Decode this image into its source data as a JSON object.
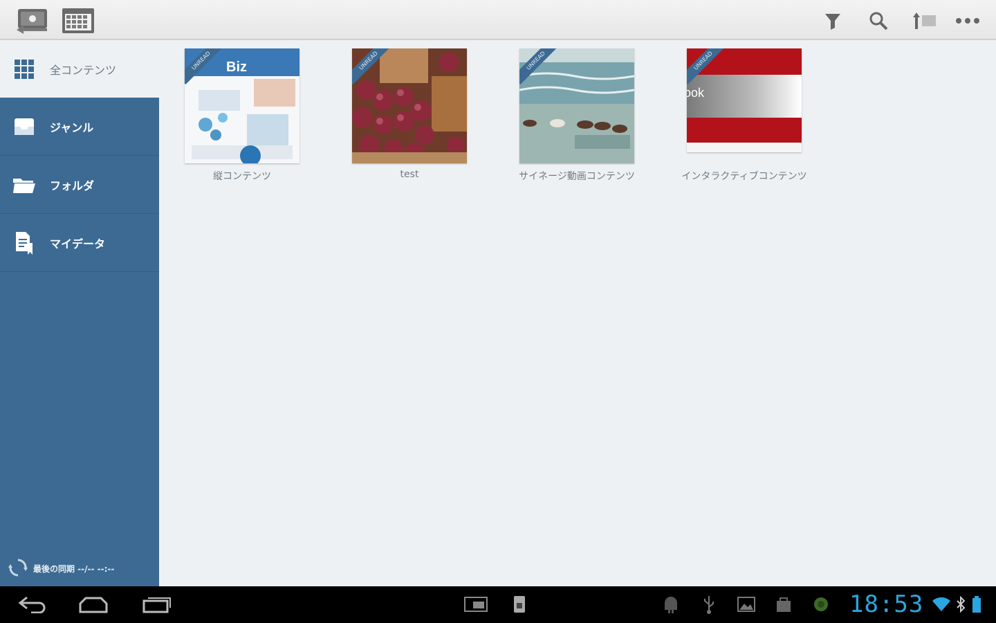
{
  "sidebar": {
    "all_label": "全コンテンツ",
    "items": [
      {
        "label": "ジャンル",
        "icon": "inbox-icon"
      },
      {
        "label": "フォルダ",
        "icon": "folder-icon"
      },
      {
        "label": "マイデータ",
        "icon": "document-icon"
      }
    ],
    "footer_label": "最後の同期 --/-- --:--"
  },
  "contents": [
    {
      "title": "縦コンテンツ",
      "badge": "UNREAD",
      "thumb": "magazine",
      "thumb_text": "Biz"
    },
    {
      "title": "test",
      "badge": "UNREAD",
      "thumb": "onions"
    },
    {
      "title": "サイネージ動画コンテンツ",
      "badge": "UNREAD",
      "thumb": "horses"
    },
    {
      "title": "インタラクティブコンテンツ",
      "badge": "UNREAD",
      "thumb": "red-book",
      "thumb_text": "ook"
    }
  ],
  "status": {
    "time": "18:53"
  },
  "colors": {
    "sidebar": "#3c6a93",
    "clock": "#2aa6e0"
  }
}
